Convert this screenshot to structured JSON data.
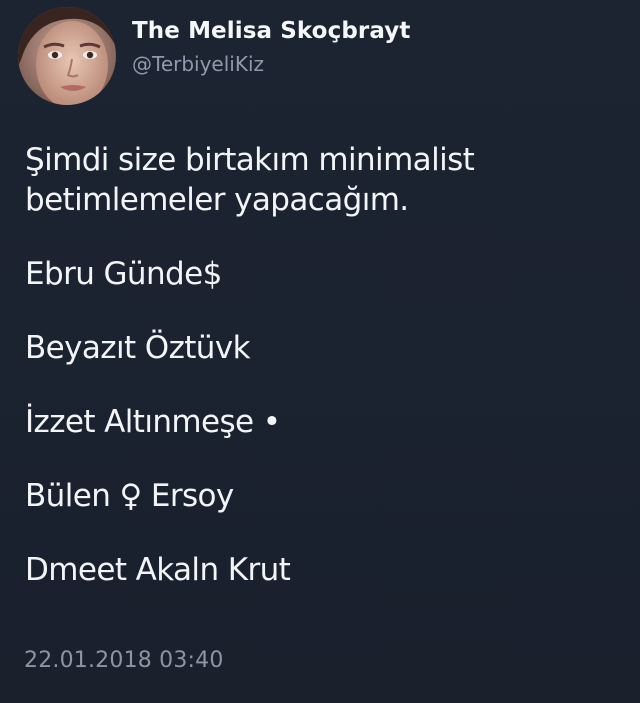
{
  "tweet": {
    "author": {
      "display_name": "The Melisa Skoçbrayt",
      "handle": "@TerbiyeliKiz",
      "avatar_icon": "profile-photo"
    },
    "lines": [
      "Şimdi size birtakım minimalist",
      "betimlemeler yapacağım.",
      "Ebru Günde$",
      "Beyazıt Öztüvk",
      "İzzet Altınmeşe •",
      "Bülen ♀ Ersoy",
      "Dmeet Akaln Krut"
    ],
    "timestamp": "22.01.2018 03:40"
  },
  "colors": {
    "background": "#1c2330",
    "text": "#f2f4f6",
    "muted": "#8e9aab"
  }
}
